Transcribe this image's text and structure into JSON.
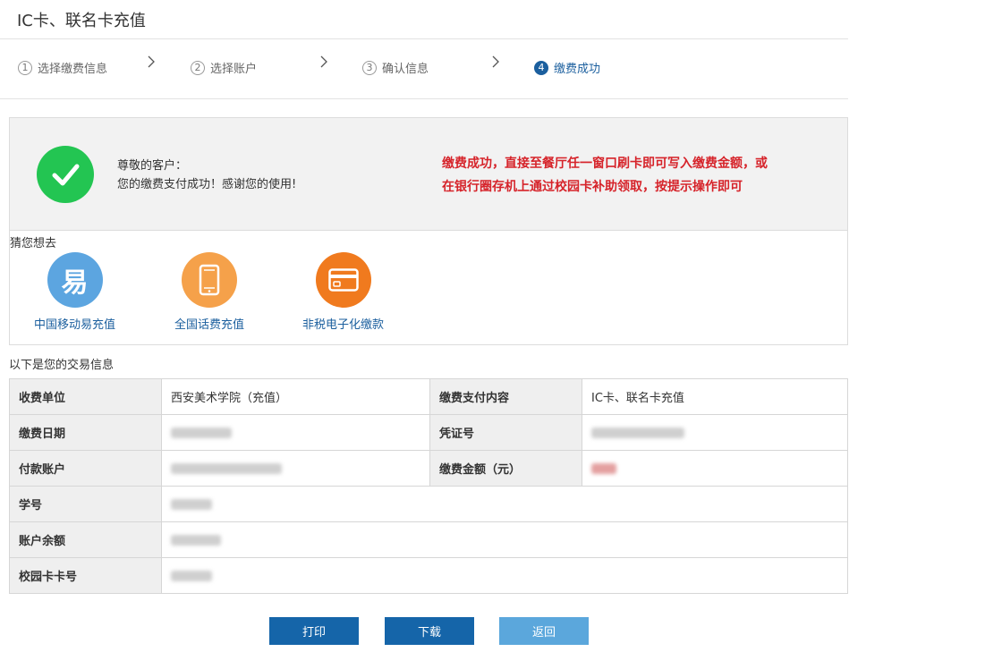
{
  "header": {
    "title": "IC卡、联名卡充值"
  },
  "steps": [
    {
      "num": "1",
      "label": "选择缴费信息"
    },
    {
      "num": "2",
      "label": "选择账户"
    },
    {
      "num": "3",
      "label": "确认信息"
    },
    {
      "num": "4",
      "label": "缴费成功"
    }
  ],
  "success": {
    "greeting": "尊敬的客户：",
    "message": "您的缴费支付成功！感谢您的使用!",
    "notice_line1": "缴费成功，直接至餐厅任一窗口刷卡即可写入缴费金额，或",
    "notice_line2": "在银行圈存机上通过校园卡补助领取，按提示操作即可"
  },
  "suggest": {
    "label": "猜您想去",
    "items": [
      {
        "label": "中国移动易充值",
        "glyph": "易",
        "icon": "yi-recharge-icon",
        "color": "#5ca5e0"
      },
      {
        "label": "全国话费充值",
        "icon": "phone-icon",
        "color": "#f5a14a"
      },
      {
        "label": "非税电子化缴款",
        "icon": "card-icon",
        "color": "#f07a1e"
      }
    ]
  },
  "info": {
    "label": "以下是您的交易信息",
    "rows": [
      {
        "k1": "收费单位",
        "v1": "西安美术学院（充值）",
        "k2": "缴费支付内容",
        "v2": "IC卡、联名卡充值"
      },
      {
        "k1": "缴费日期",
        "k2": "凭证号"
      },
      {
        "k1": "付款账户",
        "k2": "缴费金额（元）"
      },
      {
        "k1": "学号"
      },
      {
        "k1": "账户余额"
      },
      {
        "k1": "校园卡卡号"
      }
    ]
  },
  "buttons": {
    "print": "打印",
    "download": "下载",
    "back": "返回"
  },
  "colors": {
    "primary": "#1565a9",
    "accent_red": "#d6232a",
    "success_green": "#23c552"
  }
}
